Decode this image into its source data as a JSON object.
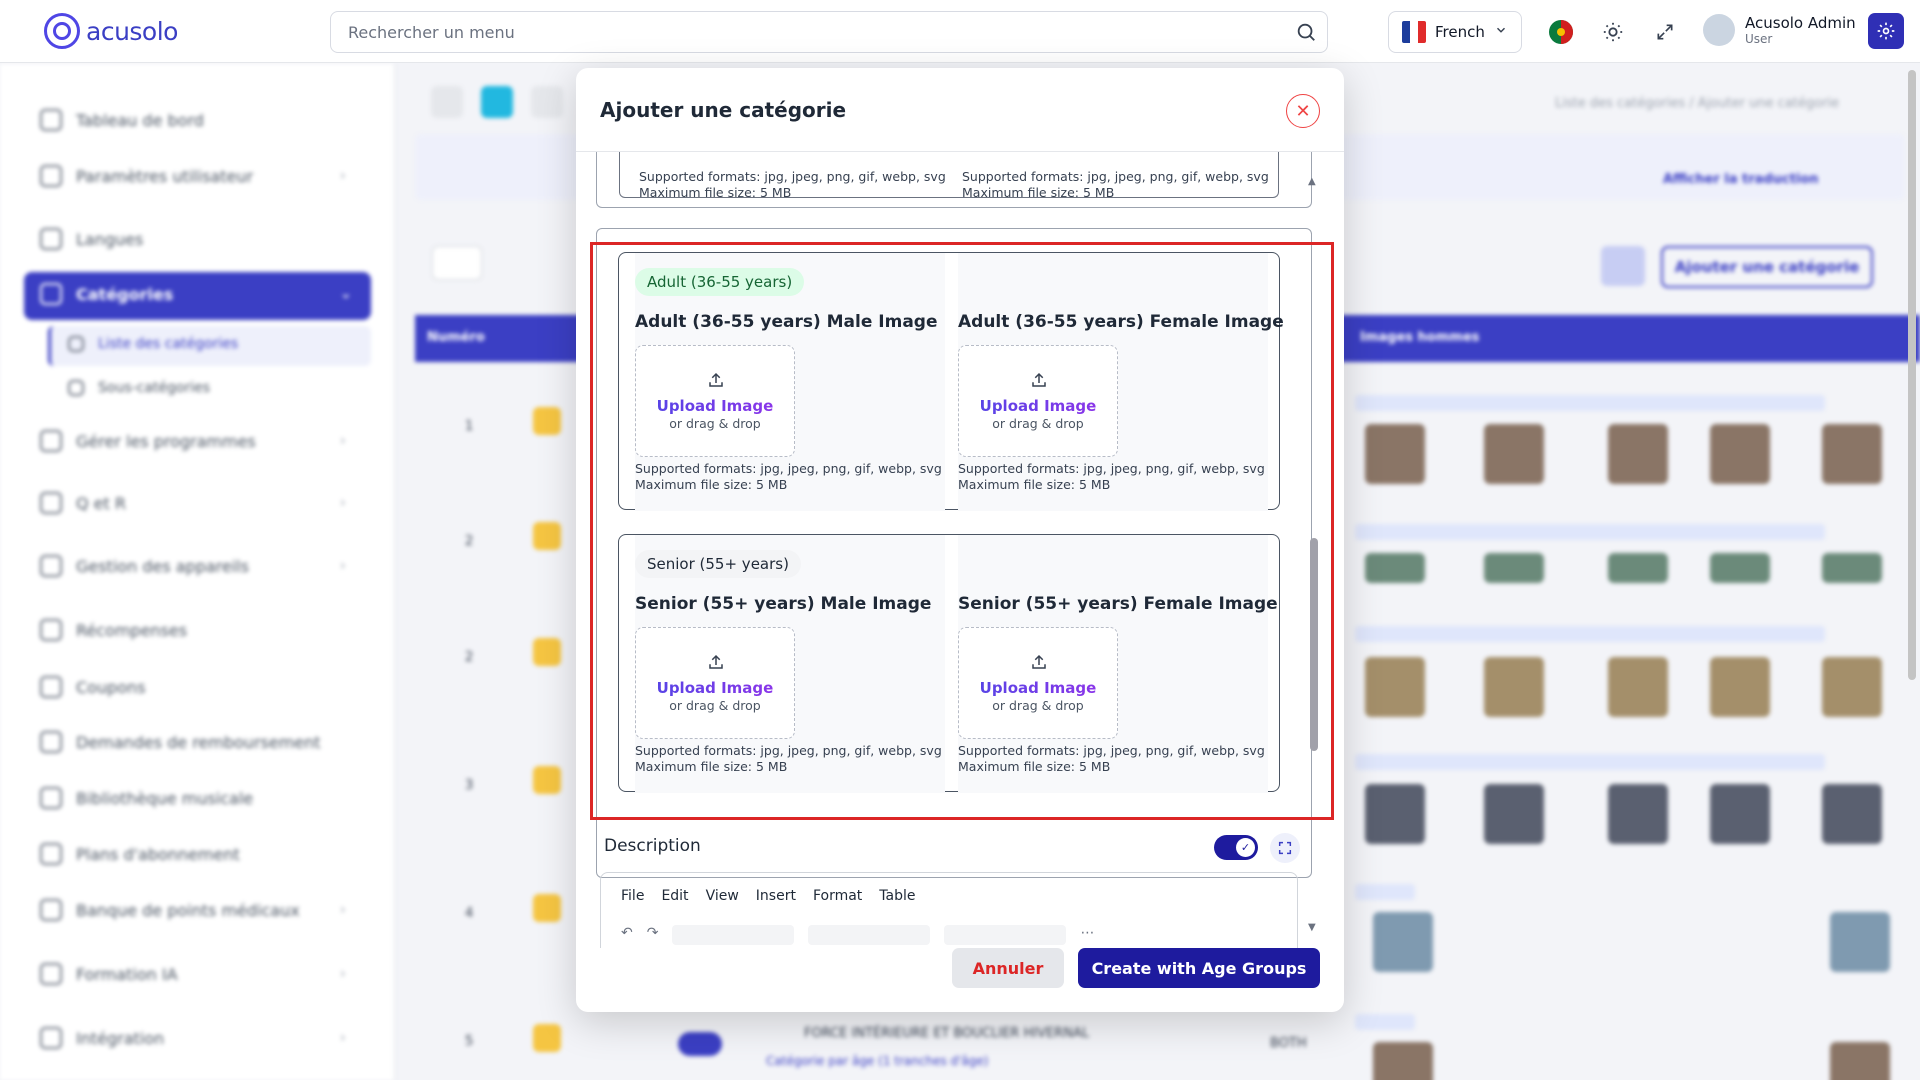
{
  "app": {
    "logo_text": "acusolo"
  },
  "topbar": {
    "search_placeholder": "Rechercher un menu",
    "language": "French",
    "user_name": "Acusolo Admin",
    "user_role": "User"
  },
  "sidebar": {
    "items": [
      {
        "label": "Tableau de bord"
      },
      {
        "label": "Paramètres utilisateur"
      },
      {
        "label": "Langues"
      },
      {
        "label": "Catégories"
      },
      {
        "label": "Liste des catégories"
      },
      {
        "label": "Sous-catégories"
      },
      {
        "label": "Gérer les programmes"
      },
      {
        "label": "Q et R"
      },
      {
        "label": "Gestion des appareils"
      },
      {
        "label": "Récompenses"
      },
      {
        "label": "Coupons"
      },
      {
        "label": "Demandes de remboursement"
      },
      {
        "label": "Bibliothèque musicale"
      },
      {
        "label": "Plans d'abonnement"
      },
      {
        "label": "Banque de points médicaux"
      },
      {
        "label": "Formation IA"
      },
      {
        "label": "Intégration"
      }
    ]
  },
  "background": {
    "breadcrumb": "Liste des catégories / Ajouter une catégorie",
    "add_button": "Ajouter une catégorie",
    "translation_toggle": "Afficher la traduction",
    "col_numero": "Numéro",
    "col_images_hommes": "Images hommes",
    "row_title": "FORCE INTÉRIEURE ET BOUCLIER HIVERNAL",
    "row_sub": "Catégorie par âge (1 tranches d'âge)",
    "row_type": "BOTH"
  },
  "modal": {
    "title": "Ajouter une catégorie",
    "formats_text": "Supported formats: jpg, jpeg, png, gif, webp, svg",
    "max_size_text": "Maximum file size: 5 MB",
    "upload_label": "Upload Image",
    "upload_sub": "or drag & drop",
    "age_groups": [
      {
        "badge": "Adult (36-55 years)",
        "male_title": "Adult (36-55 years) Male Image",
        "female_title": "Adult (36-55 years) Female Image"
      },
      {
        "badge": "Senior (55+ years)",
        "male_title": "Senior (55+ years) Male Image",
        "female_title": "Senior (55+ years) Female Image"
      }
    ],
    "description_label": "Description",
    "editor_menu": [
      "File",
      "Edit",
      "View",
      "Insert",
      "Format",
      "Table"
    ],
    "cancel_label": "Annuler",
    "create_label": "Create with Age Groups"
  },
  "colors": {
    "primary": "#1e1b9e",
    "accent": "#3b3fc4",
    "danger": "#dc2626",
    "adult_badge_bg": "#dcfce7",
    "senior_badge_bg": "#f3f4f6"
  }
}
